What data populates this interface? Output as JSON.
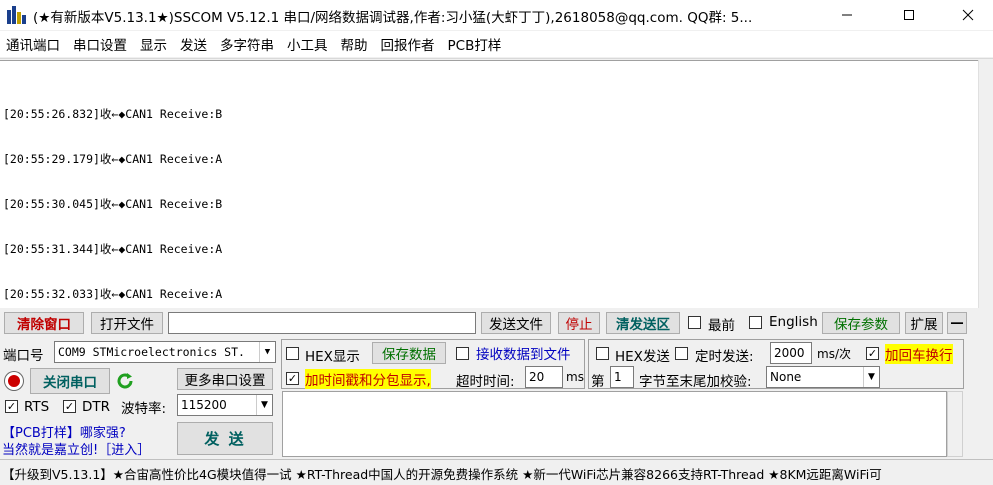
{
  "window": {
    "title": "(★有新版本V5.13.1★)SSCOM V5.12.1 串口/网络数据调试器,作者:习小猛(大虾丁丁),2618058@qq.com. QQ群: 5...",
    "min_icon": "minimize-icon",
    "max_icon": "maximize-icon",
    "close_icon": "close-icon"
  },
  "menu": [
    "通讯端口",
    "串口设置",
    "显示",
    "发送",
    "多字符串",
    "小工具",
    "帮助",
    "回报作者",
    "PCB打样"
  ],
  "receive": {
    "lines": [
      "[20:55:26.832]收←◆CAN1 Receive:B",
      "[20:55:29.179]收←◆CAN1 Receive:A",
      "[20:55:30.045]收←◆CAN1 Receive:B",
      "[20:55:31.344]收←◆CAN1 Receive:A",
      "[20:55:32.033]收←◆CAN1 Receive:A"
    ]
  },
  "toolbar": {
    "clear_window": "清除窗口",
    "open_file": "打开文件",
    "file_path": "",
    "send_file": "发送文件",
    "stop": "停止",
    "clear_send": "清发送区",
    "front_most": "最前",
    "english": "English",
    "save_params": "保存参数",
    "expand": "扩展",
    "collapse": "—"
  },
  "port": {
    "port_label": "端口号",
    "port_value": "COM9 STMicroelectronics ST.",
    "close_port": "关闭串口",
    "more_settings": "更多串口设置",
    "rts": "RTS",
    "dtr": "DTR",
    "baud_label": "波特率:",
    "baud_value": "115200"
  },
  "options": {
    "hex_display": "HEX显示",
    "save_data": "保存数据",
    "recv_to_file": "接收数据到文件",
    "timestamp": "加时间戳和分包显示,",
    "timeout_label": "超时时间:",
    "timeout_value": "20",
    "timeout_unit": "ms",
    "byte_label_pre": "第",
    "byte_value": "1",
    "byte_label_post": "字节至末尾加校验:",
    "checksum_value": "None",
    "hex_send": "HEX发送",
    "timed_send": "定时发送:",
    "interval_value": "2000",
    "interval_unit": "ms/次",
    "add_crlf": "加回车换行"
  },
  "ad": {
    "line1": "【PCB打样】哪家强?",
    "line2": "当然就是嘉立创!［进入］"
  },
  "send_button": "发 送",
  "status": "【升级到V5.13.1】★合宙高性价比4G模块值得一试 ★RT-Thread中国人的开源免费操作系统 ★新一代WiFi芯片兼容8266支持RT-Thread ★8KM远距离WiFi可"
}
